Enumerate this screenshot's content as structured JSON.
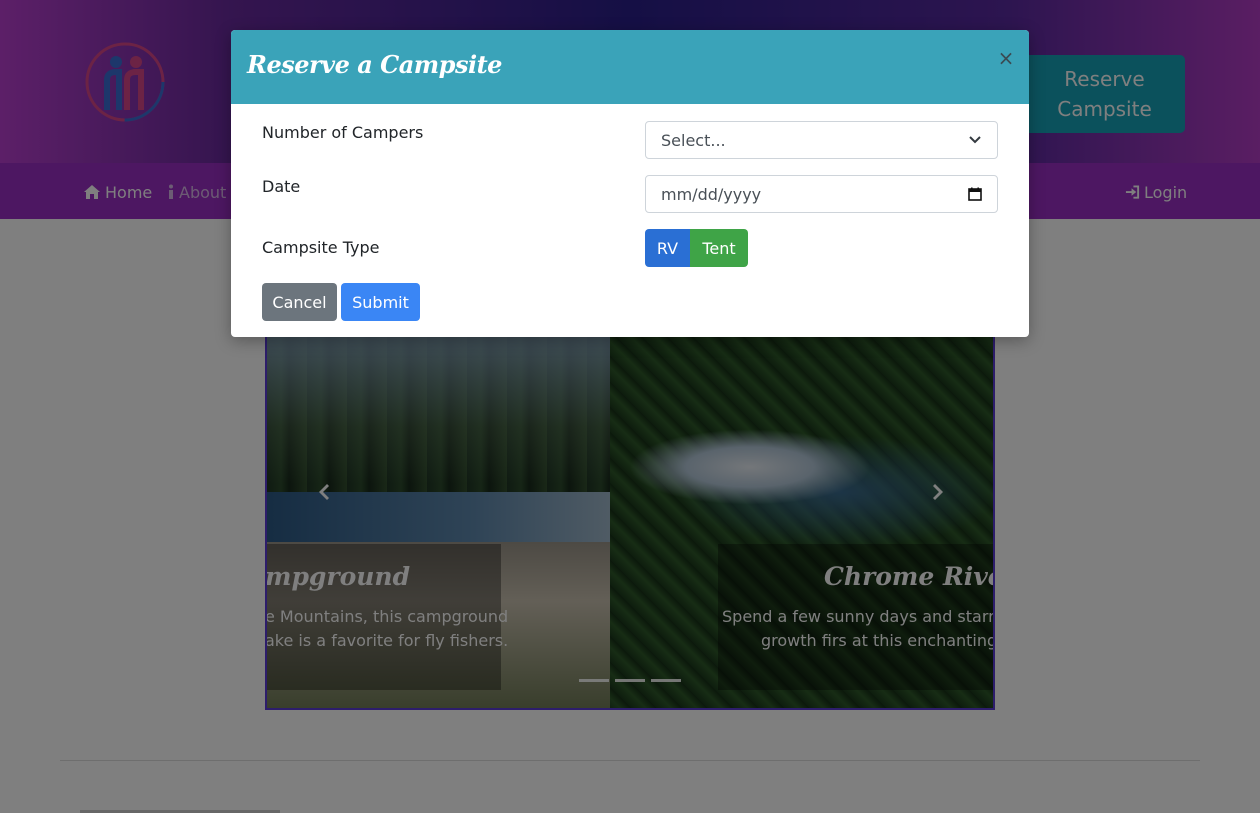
{
  "header": {
    "reserve_button": "Reserve Campsite"
  },
  "nav": {
    "home": "Home",
    "about": "About",
    "login": "Login"
  },
  "carousel": {
    "left_caption": {
      "title": "mpground",
      "line1": "e Mountains, this campground",
      "line2": "ake is a favorite for fly fishers."
    },
    "right_caption": {
      "title": "Chrome River C",
      "line1": "Spend a few sunny days and starry n",
      "line2": "growth firs at this enchanting s"
    },
    "indicator_count": 3
  },
  "modal": {
    "title": "Reserve a Campsite",
    "close_symbol": "×",
    "fields": {
      "campers_label": "Number of Campers",
      "campers_value": "Select...",
      "date_label": "Date",
      "date_placeholder": "mm/dd/yyyy",
      "type_label": "Campsite Type",
      "type_options": [
        "RV",
        "Tent"
      ]
    },
    "buttons": {
      "cancel": "Cancel",
      "submit": "Submit"
    }
  },
  "colors": {
    "modal_header": "#3aa3b9",
    "reserve_button": "#17a2b8",
    "rv_button": "#2a6fd4",
    "tent_button": "#3fa447",
    "cancel_button": "#6c757d",
    "submit_button": "#3a86f5"
  }
}
